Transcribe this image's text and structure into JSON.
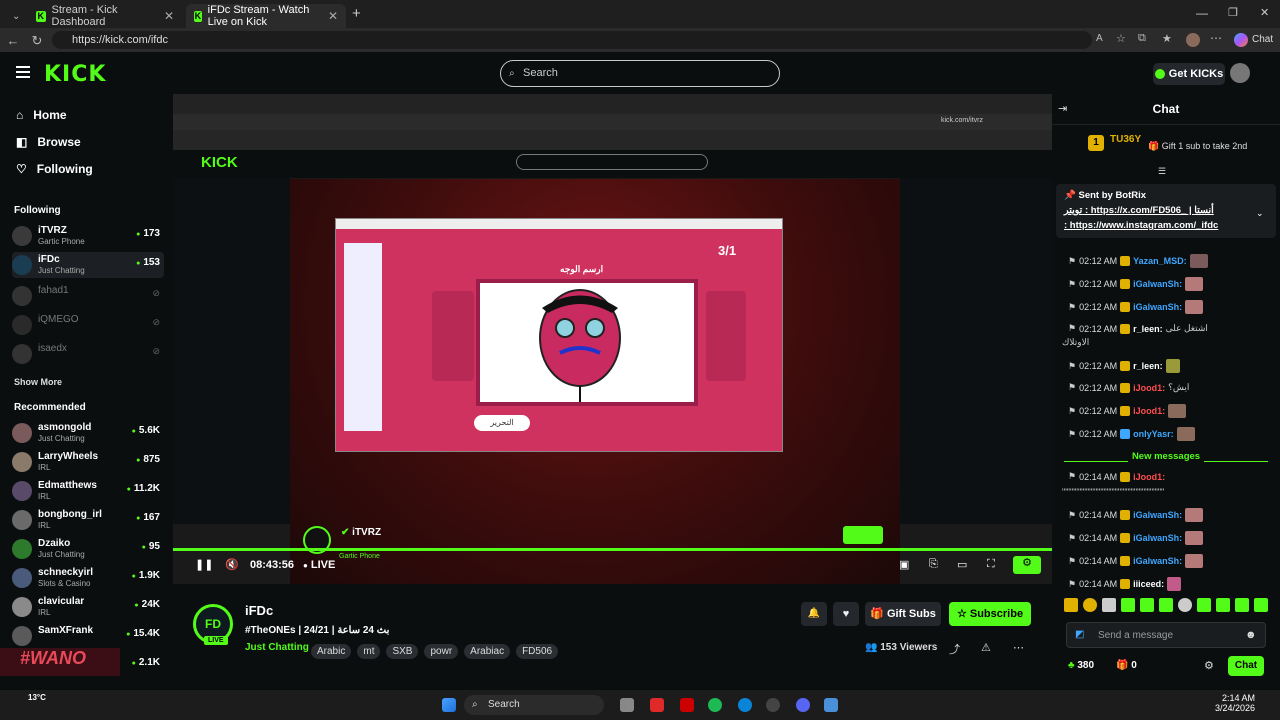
{
  "browser": {
    "tabs": [
      {
        "title": "Stream - Kick Dashboard",
        "active": false
      },
      {
        "title": "iFDc Stream - Watch Live on Kick",
        "active": true
      }
    ],
    "url": "https://kick.com/ifdc"
  },
  "header": {
    "search_placeholder": "Search",
    "get_kicks": "Get KICKs",
    "logo": "KICK"
  },
  "sidebar": {
    "nav": [
      {
        "label": "Home",
        "icon": "home-icon"
      },
      {
        "label": "Browse",
        "icon": "compass-icon"
      },
      {
        "label": "Following",
        "icon": "heart-icon"
      }
    ],
    "following_title": "Following",
    "following": [
      {
        "name": "iTVRZ",
        "category": "Gartic Phone",
        "viewers": "173",
        "live": true
      },
      {
        "name": "iFDc",
        "category": "Just Chatting",
        "viewers": "153",
        "live": true
      },
      {
        "name": "fahad1",
        "category": "",
        "viewers": "",
        "live": false
      },
      {
        "name": "iQMEGO",
        "category": "",
        "viewers": "",
        "live": false
      },
      {
        "name": "isaedx",
        "category": "",
        "viewers": "",
        "live": false
      }
    ],
    "show_more": "Show More",
    "recommended_title": "Recommended",
    "recommended": [
      {
        "name": "asmongold",
        "category": "Just Chatting",
        "viewers": "5.6K"
      },
      {
        "name": "LarryWheels",
        "category": "IRL",
        "viewers": "875"
      },
      {
        "name": "Edmatthews",
        "category": "IRL",
        "viewers": "11.2K"
      },
      {
        "name": "bongbong_irl",
        "category": "IRL",
        "viewers": "167"
      },
      {
        "name": "Dzaiko",
        "category": "Just Chatting",
        "viewers": "95"
      },
      {
        "name": "schneckyirl",
        "category": "Slots & Casino",
        "viewers": "1.9K"
      },
      {
        "name": "clavicular",
        "category": "IRL",
        "viewers": "24K"
      },
      {
        "name": "SamXFrank",
        "category": "",
        "viewers": "15.4K"
      },
      {
        "name": "",
        "category": "",
        "viewers": "2.1K"
      }
    ]
  },
  "player": {
    "streamer_overlay": "iTVRZ",
    "overlay_category": "Gartic Phone",
    "game_score": "3/1",
    "game_prompt": "ارسم الوجه",
    "time": "08:43:56",
    "live_label": "LIVE",
    "inner_url": "kick.com/itvrz"
  },
  "channel": {
    "name": "iFDc",
    "title": "#TheONEs | 24/21 | بث 24 ساعة",
    "category": "Just Chatting",
    "tags": [
      "Arabic",
      "mt",
      "SXB",
      "powr",
      "Arabiac",
      "FD506"
    ],
    "viewers": "153 Viewers",
    "gift_subs": "Gift Subs",
    "subscribe": "Subscribe",
    "live_badge": "LIVE"
  },
  "chat": {
    "title": "Chat",
    "top_gifter": "TU36Y",
    "top_gifter_count": "1",
    "gift_prompt": "Gift 1 sub to take 2nd",
    "pinned_by_label": "Sent by",
    "pinned_by": "BotRix",
    "pinned_text1": "تويتر : https://x.com/FD506_ | أنستا",
    "pinned_text2": ": https://www.instagram.com/_ifdc",
    "messages": [
      {
        "time": "02:12 AM",
        "user": "Yazan_MSD:",
        "text": "",
        "color": "#3fa7ff"
      },
      {
        "time": "02:12 AM",
        "user": "iGalwanSh:",
        "text": "",
        "color": "#3fa7ff"
      },
      {
        "time": "02:12 AM",
        "user": "iGalwanSh:",
        "text": "",
        "color": "#3fa7ff"
      },
      {
        "time": "02:12 AM",
        "user": "r_leen:",
        "text": "اشتغل على",
        "color": "#ffffff"
      },
      {
        "time": "",
        "user": "",
        "text": "الاوتلاك",
        "color": "#ffffff"
      },
      {
        "time": "02:12 AM",
        "user": "r_leen:",
        "text": "",
        "color": "#ffffff"
      },
      {
        "time": "02:12 AM",
        "user": "iJood1:",
        "text": "ايش؟",
        "color": "#ff4d4d"
      },
      {
        "time": "02:12 AM",
        "user": "iJood1:",
        "text": "",
        "color": "#ff4d4d"
      },
      {
        "time": "02:12 AM",
        "user": "onlyYasr:",
        "text": "",
        "color": "#3fa7ff"
      }
    ],
    "new_messages": "New messages",
    "messages2": [
      {
        "time": "02:14 AM",
        "user": "iJood1:",
        "text": "",
        "color": "#ff4d4d"
      },
      {
        "time": "",
        "user": "",
        "text": "\"\"\"\"\"\"\"\"\"\"\"\"\"\"\"\"\"\"\"\"\"\"\"\"\"\"\"\"\"\"\"\"",
        "color": "#ffffff"
      },
      {
        "time": "02:14 AM",
        "user": "iGalwanSh:",
        "text": "",
        "color": "#3fa7ff"
      },
      {
        "time": "02:14 AM",
        "user": "iGalwanSh:",
        "text": "",
        "color": "#3fa7ff"
      },
      {
        "time": "02:14 AM",
        "user": "iGalwanSh:",
        "text": "",
        "color": "#3fa7ff"
      },
      {
        "time": "02:14 AM",
        "user": "iiiceed:",
        "text": "",
        "color": "#ffffff"
      }
    ],
    "send_placeholder": "Send a message",
    "points": "380",
    "gifts": "0",
    "chat_button": "Chat"
  },
  "taskbar": {
    "search": "Search",
    "time": "2:14 AM",
    "date": "3/24/2026",
    "weather": "13°C"
  },
  "colors": {
    "accent": "#53fc18",
    "bg": "#0b0e0f",
    "panel": "#24272c"
  }
}
